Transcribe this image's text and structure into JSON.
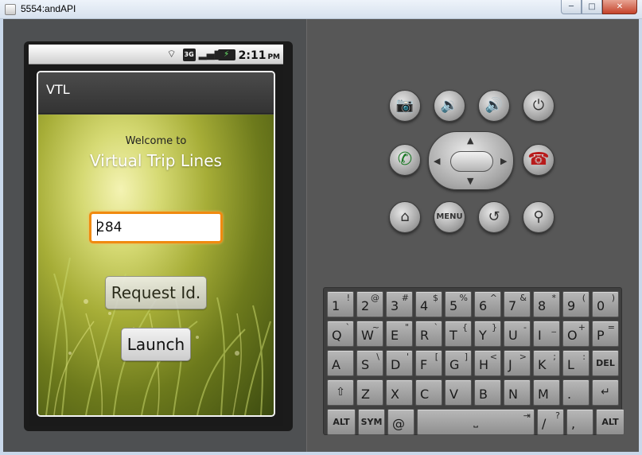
{
  "window": {
    "title": "5554:andAPI",
    "min_label": "─",
    "max_label": "□",
    "close_label": "✕"
  },
  "statusbar": {
    "time": "2:11",
    "ampm": "PM",
    "icons": [
      "wifi-icon",
      "3g-icon",
      "signal-icon",
      "battery-icon"
    ],
    "icon_3g": "3G",
    "icon_signal": "▂▄▆",
    "icon_wifi": "⌔",
    "icon_battery": "⚡"
  },
  "dialog": {
    "title": "VTL",
    "welcome": "Welcome to",
    "app_name": "Virtual Trip Lines",
    "input_value": "284",
    "request_button": "Request Id.",
    "launch_button": "Launch"
  },
  "hardware": {
    "camera": "📷",
    "vol_down": "🔉",
    "vol_up": "🔊",
    "power": "⏻",
    "call": "✆",
    "end_call": "☎",
    "home": "⌂",
    "menu": "MENU",
    "back": "↺",
    "search": "⚲",
    "arrow_up": "▲",
    "arrow_down": "▼",
    "arrow_left": "◀",
    "arrow_right": "▶"
  },
  "keyboard": {
    "rows": [
      [
        [
          "1",
          "!"
        ],
        [
          "2",
          "@"
        ],
        [
          "3",
          "#"
        ],
        [
          "4",
          "$"
        ],
        [
          "5",
          "%"
        ],
        [
          "6",
          "^"
        ],
        [
          "7",
          "&"
        ],
        [
          "8",
          "*"
        ],
        [
          "9",
          "("
        ],
        [
          "0",
          ")"
        ]
      ],
      [
        [
          "Q",
          "`"
        ],
        [
          "W",
          "~"
        ],
        [
          "E",
          "\""
        ],
        [
          "R",
          "`"
        ],
        [
          "T",
          "{"
        ],
        [
          "Y",
          "}"
        ],
        [
          "U",
          "-"
        ],
        [
          "I",
          "_"
        ],
        [
          "O",
          "+"
        ],
        [
          "P",
          "="
        ]
      ],
      [
        [
          "A",
          ""
        ],
        [
          "S",
          "\\"
        ],
        [
          "D",
          "'"
        ],
        [
          "F",
          "["
        ],
        [
          "G",
          "]"
        ],
        [
          "H",
          "<"
        ],
        [
          "J",
          ">"
        ],
        [
          "K",
          ";"
        ],
        [
          "L",
          ":"
        ],
        [
          "DEL",
          ""
        ]
      ],
      [
        [
          "⇧",
          ""
        ],
        [
          "Z",
          ""
        ],
        [
          "X",
          ""
        ],
        [
          "C",
          ""
        ],
        [
          "V",
          ""
        ],
        [
          "B",
          ""
        ],
        [
          "N",
          ""
        ],
        [
          "M",
          ""
        ],
        [
          ".",
          ""
        ],
        [
          "↵",
          ""
        ]
      ],
      [
        [
          "ALT",
          ""
        ],
        [
          "SYM",
          ""
        ],
        [
          "@",
          ""
        ],
        [
          "⎵",
          "⇥"
        ],
        [
          "/",
          "?"
        ],
        [
          ",",
          ""
        ],
        [
          "ALT",
          ""
        ]
      ]
    ]
  }
}
